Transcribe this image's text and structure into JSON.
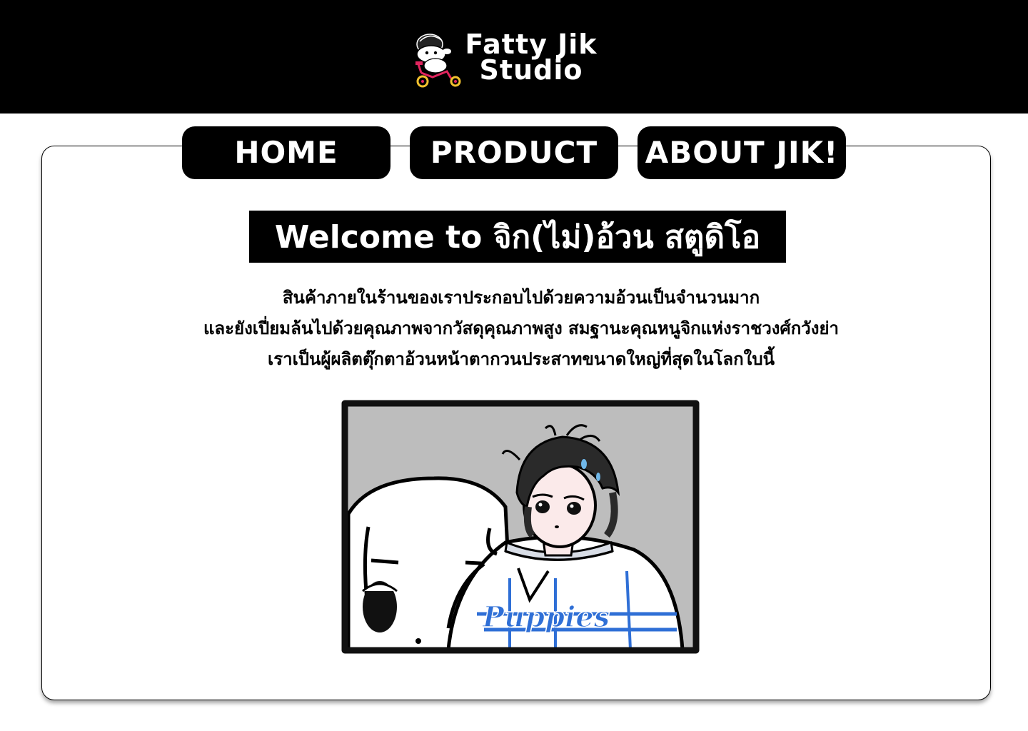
{
  "header": {
    "brand_line1": "Fatty Jik",
    "brand_line2": "Studio",
    "logo_icon": "mascot-on-tricycle-icon",
    "background": "#000000"
  },
  "nav": {
    "items": [
      {
        "label": "HOME"
      },
      {
        "label": "PRODUCT"
      },
      {
        "label": "ABOUT JIK!"
      }
    ]
  },
  "main": {
    "title": "Welcome to จิก(ไม่)อ้วน สตูดิโอ",
    "description": [
      "สินค้าภายในร้านของเราประกอบไปด้วยความอ้วนเป็นจำนวนมาก",
      "และยังเปี่ยมล้นไปด้วยคุณภาพจากวัสดุคุณภาพสูง สมฐานะคุณหนูจิกแห่งราชวงศ์กวังย่า",
      "เราเป็นผู้ผลิตตุ๊กตาอ้วนหน้าตากวนประสาทขนาดใหญ่ที่สุดในโลกใบนี้"
    ],
    "illustration_text": "Puppies"
  },
  "colors": {
    "black": "#000000",
    "white": "#ffffff",
    "panel_gray": "#bdbdbd",
    "jersey_blue": "#2f6fd6"
  }
}
